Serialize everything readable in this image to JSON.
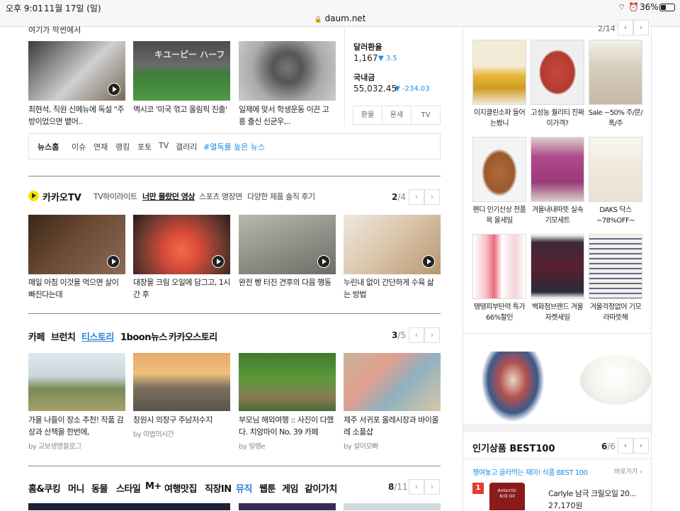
{
  "statusbar": {
    "time": "오후 9:01",
    "date": "11월 17일 (일)",
    "url": "daum.net",
    "battery": "36%"
  },
  "top_cut_heading": "여기가 막썬에서",
  "news_row": [
    {
      "caption": "최현석, 직원 신메뉴에 독설 \"주방이었으면 뱉어.."
    },
    {
      "caption": "멕시코 '미국 꺾고 올림픽 진출'"
    },
    {
      "caption": "일제에 맞서 학생운동 이끈 고흥 출신 신균우,.."
    }
  ],
  "finance": {
    "fx_label": "달러환율",
    "fx_value": "1,167",
    "fx_change": "3.5",
    "kospi_label": "국내금",
    "kospi_value": "55,032.45",
    "kospi_change": "-234.03",
    "tabs": [
      "환율",
      "운세",
      "TV"
    ]
  },
  "news_home": {
    "label": "뉴스홈",
    "items": [
      "이슈",
      "연재",
      "랭킹",
      "포토",
      "TV",
      "갤러리"
    ],
    "highlight": "#열독률 높은 뉴스"
  },
  "kakao_tv": {
    "title": "카카오TV",
    "tabs": [
      "TV하이라이트",
      "너만 몰랐던 영상",
      "스포츠 명장면",
      "다양한 제품 솔직 후기"
    ],
    "page": "2",
    "total": "/4",
    "items": [
      {
        "caption": "매일 아침 이것을 먹으면 살이 빠진다는데"
      },
      {
        "caption": "대창을 크림 오일에 담그고, 1시간 후"
      },
      {
        "caption": "완전 빵 터진 견후의 다음 행동"
      },
      {
        "caption": "누린내 없이 간단하게 수육 삶는 방법"
      }
    ]
  },
  "cafe": {
    "tabs": [
      "카페",
      "브런치",
      "티스토리",
      "1boon뉴스",
      "카카오스토리"
    ],
    "page": "3",
    "total": "/5",
    "items": [
      {
        "caption": "가을 나들이 장소 추천! 작품 감상과 산책을 한번에,",
        "source": "by 교보생명블로그"
      },
      {
        "caption": "창원시 의창구 주남저수지",
        "source": "by 마법의시간"
      },
      {
        "caption": "부모님 해외여행 :: 사진이 다했다. 치앙마이 No. 39 카페",
        "source": "by 알랭e"
      },
      {
        "caption": "제주 서귀포 올레시장과 바이올레 소품샵",
        "source": "by 설이오빠"
      }
    ]
  },
  "categories": {
    "tabs": [
      "홈&쿠킹",
      "머니",
      "동물",
      "스타일",
      "M+",
      "여행맛집",
      "직장IN",
      "뮤직",
      "웹툰",
      "게임",
      "같이가치"
    ],
    "page": "8",
    "total": "/11"
  },
  "shopping": {
    "top_page": "2/14",
    "products": [
      {
        "label": "이지클린소파 들어는봤니"
      },
      {
        "label": "고성능 퀄리티 진짜 이가격?"
      },
      {
        "label": "Sale ~50% 주/문/폭/주"
      },
      {
        "label": "펜디 인기신상 전품목 올세일"
      },
      {
        "label": "겨울내내따뜻 실속기모세트"
      },
      {
        "label": "DAKS 닥스 ~78%OFF~"
      },
      {
        "label": "탱탱피부탄력 특가66%할인"
      },
      {
        "label": "백화점브랜드 겨울자켓세일"
      },
      {
        "label": "겨울걱정없어 기모라따뜻해"
      }
    ]
  },
  "best100": {
    "title": "인기상품 BEST100",
    "page": "6",
    "total": "/6",
    "promo": "쟁여놓고 골라먹는 재미! 식품 BEST 100",
    "more": "바로가기 ›",
    "rank": "1",
    "item_name": "Carlyle 남극 크릴오일 20...",
    "item_price": "27,170원",
    "item_label": "Antarctic Krill Oil"
  },
  "colors": {
    "accent": "#1b8ee6",
    "tistory": "#2b84d8",
    "kakao_yellow": "#f7e600",
    "red": "#e23c2e"
  }
}
